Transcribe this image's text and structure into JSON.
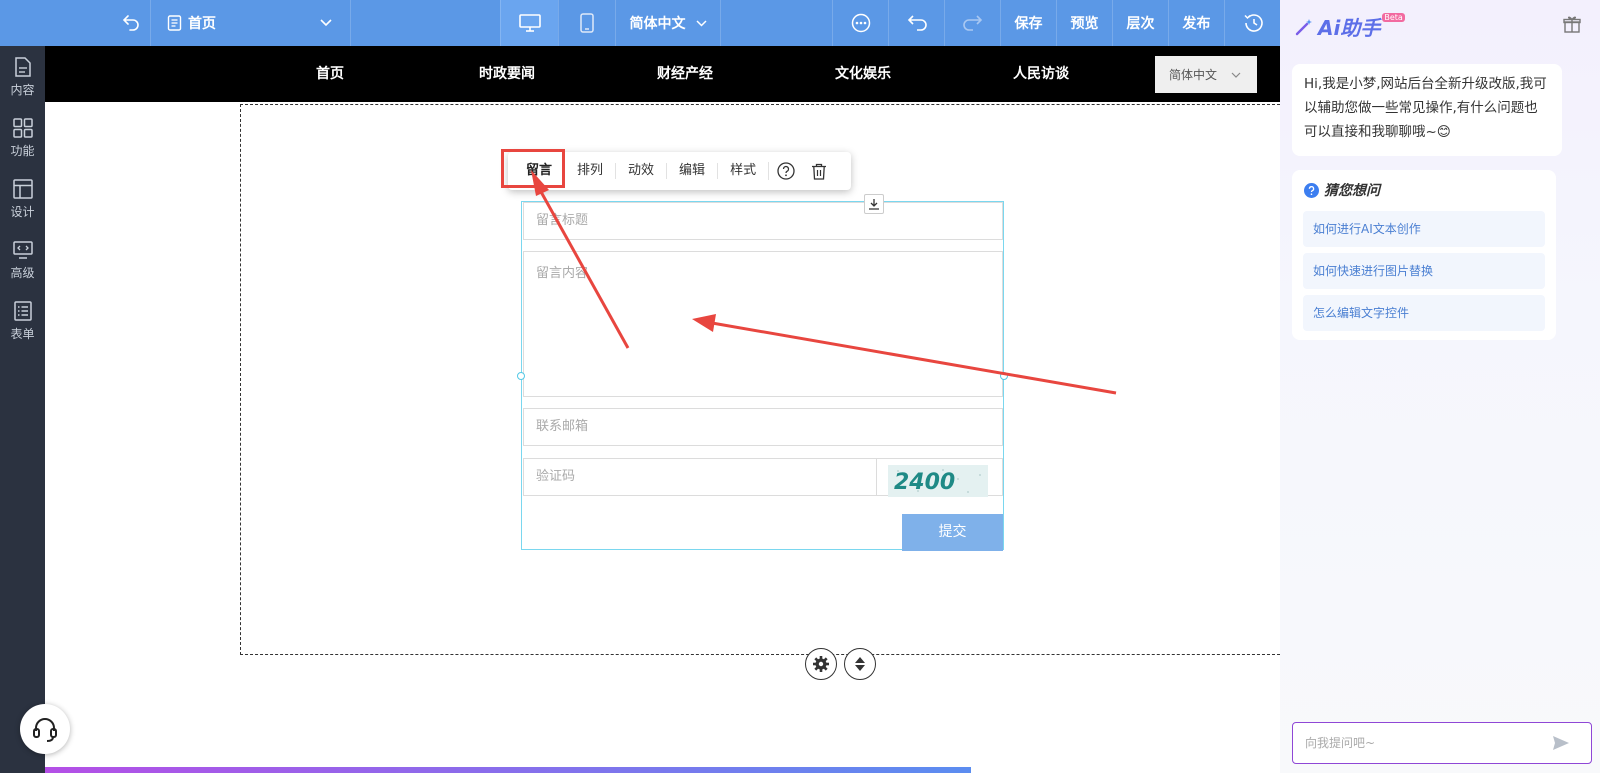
{
  "topbar": {
    "page_name": "首页",
    "language": "简体中文",
    "save": "保存",
    "preview": "预览",
    "layers": "层次",
    "publish": "发布"
  },
  "sidebar": {
    "items": [
      {
        "label": "内容",
        "icon": "document-icon"
      },
      {
        "label": "功能",
        "icon": "grid-icon"
      },
      {
        "label": "设计",
        "icon": "layout-icon"
      },
      {
        "label": "高级",
        "icon": "code-monitor-icon"
      },
      {
        "label": "表单",
        "icon": "form-list-icon"
      }
    ]
  },
  "site_nav": {
    "items": [
      "首页",
      "时政要闻",
      "财经产经",
      "文化娱乐",
      "人民访谈"
    ],
    "language": "简体中文"
  },
  "context_toolbar": {
    "items": [
      "留言",
      "排列",
      "动效",
      "编辑",
      "样式"
    ]
  },
  "form": {
    "title_placeholder": "留言标题",
    "content_placeholder": "留言内容",
    "email_placeholder": "联系邮箱",
    "captcha_placeholder": "验证码",
    "captcha_text": "2400",
    "submit_label": "提交"
  },
  "ai_assistant": {
    "title": "Ai助手",
    "badge": "Beta",
    "greeting": "Hi,我是小梦,网站后台全新升级改版,我可以辅助您做一些常见操作,有什么问题也可以直接和我聊聊哦~😊",
    "suggest_title": "猜您想问",
    "questions": [
      "如何进行AI文本创作",
      "如何快速进行图片替换",
      "怎么编辑文字控件"
    ],
    "input_placeholder": "向我提问吧~"
  },
  "progress": {
    "value": 0.75
  },
  "colors": {
    "accent": "#5b98e6",
    "annotation_red": "#e8463f",
    "ai_purple": "#8f47d6"
  }
}
